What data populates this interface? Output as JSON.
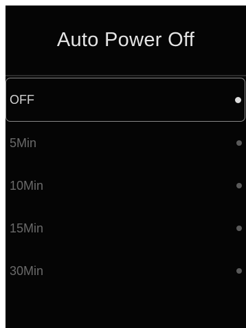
{
  "screen": {
    "title": "Auto Power Off"
  },
  "options": [
    {
      "label": "OFF",
      "selected": true
    },
    {
      "label": "5Min",
      "selected": false
    },
    {
      "label": "10Min",
      "selected": false
    },
    {
      "label": "15Min",
      "selected": false
    },
    {
      "label": "30Min",
      "selected": false
    }
  ],
  "colors": {
    "background": "#050505",
    "title_text": "#e4e4e4",
    "selected_text": "#d2d2d2",
    "unselected_text": "#6a6a6a",
    "selected_border": "#8a8a8a"
  },
  "icons": {
    "selected_indicator": "radio-dot-filled-icon",
    "unselected_indicator": "radio-dot-icon"
  }
}
